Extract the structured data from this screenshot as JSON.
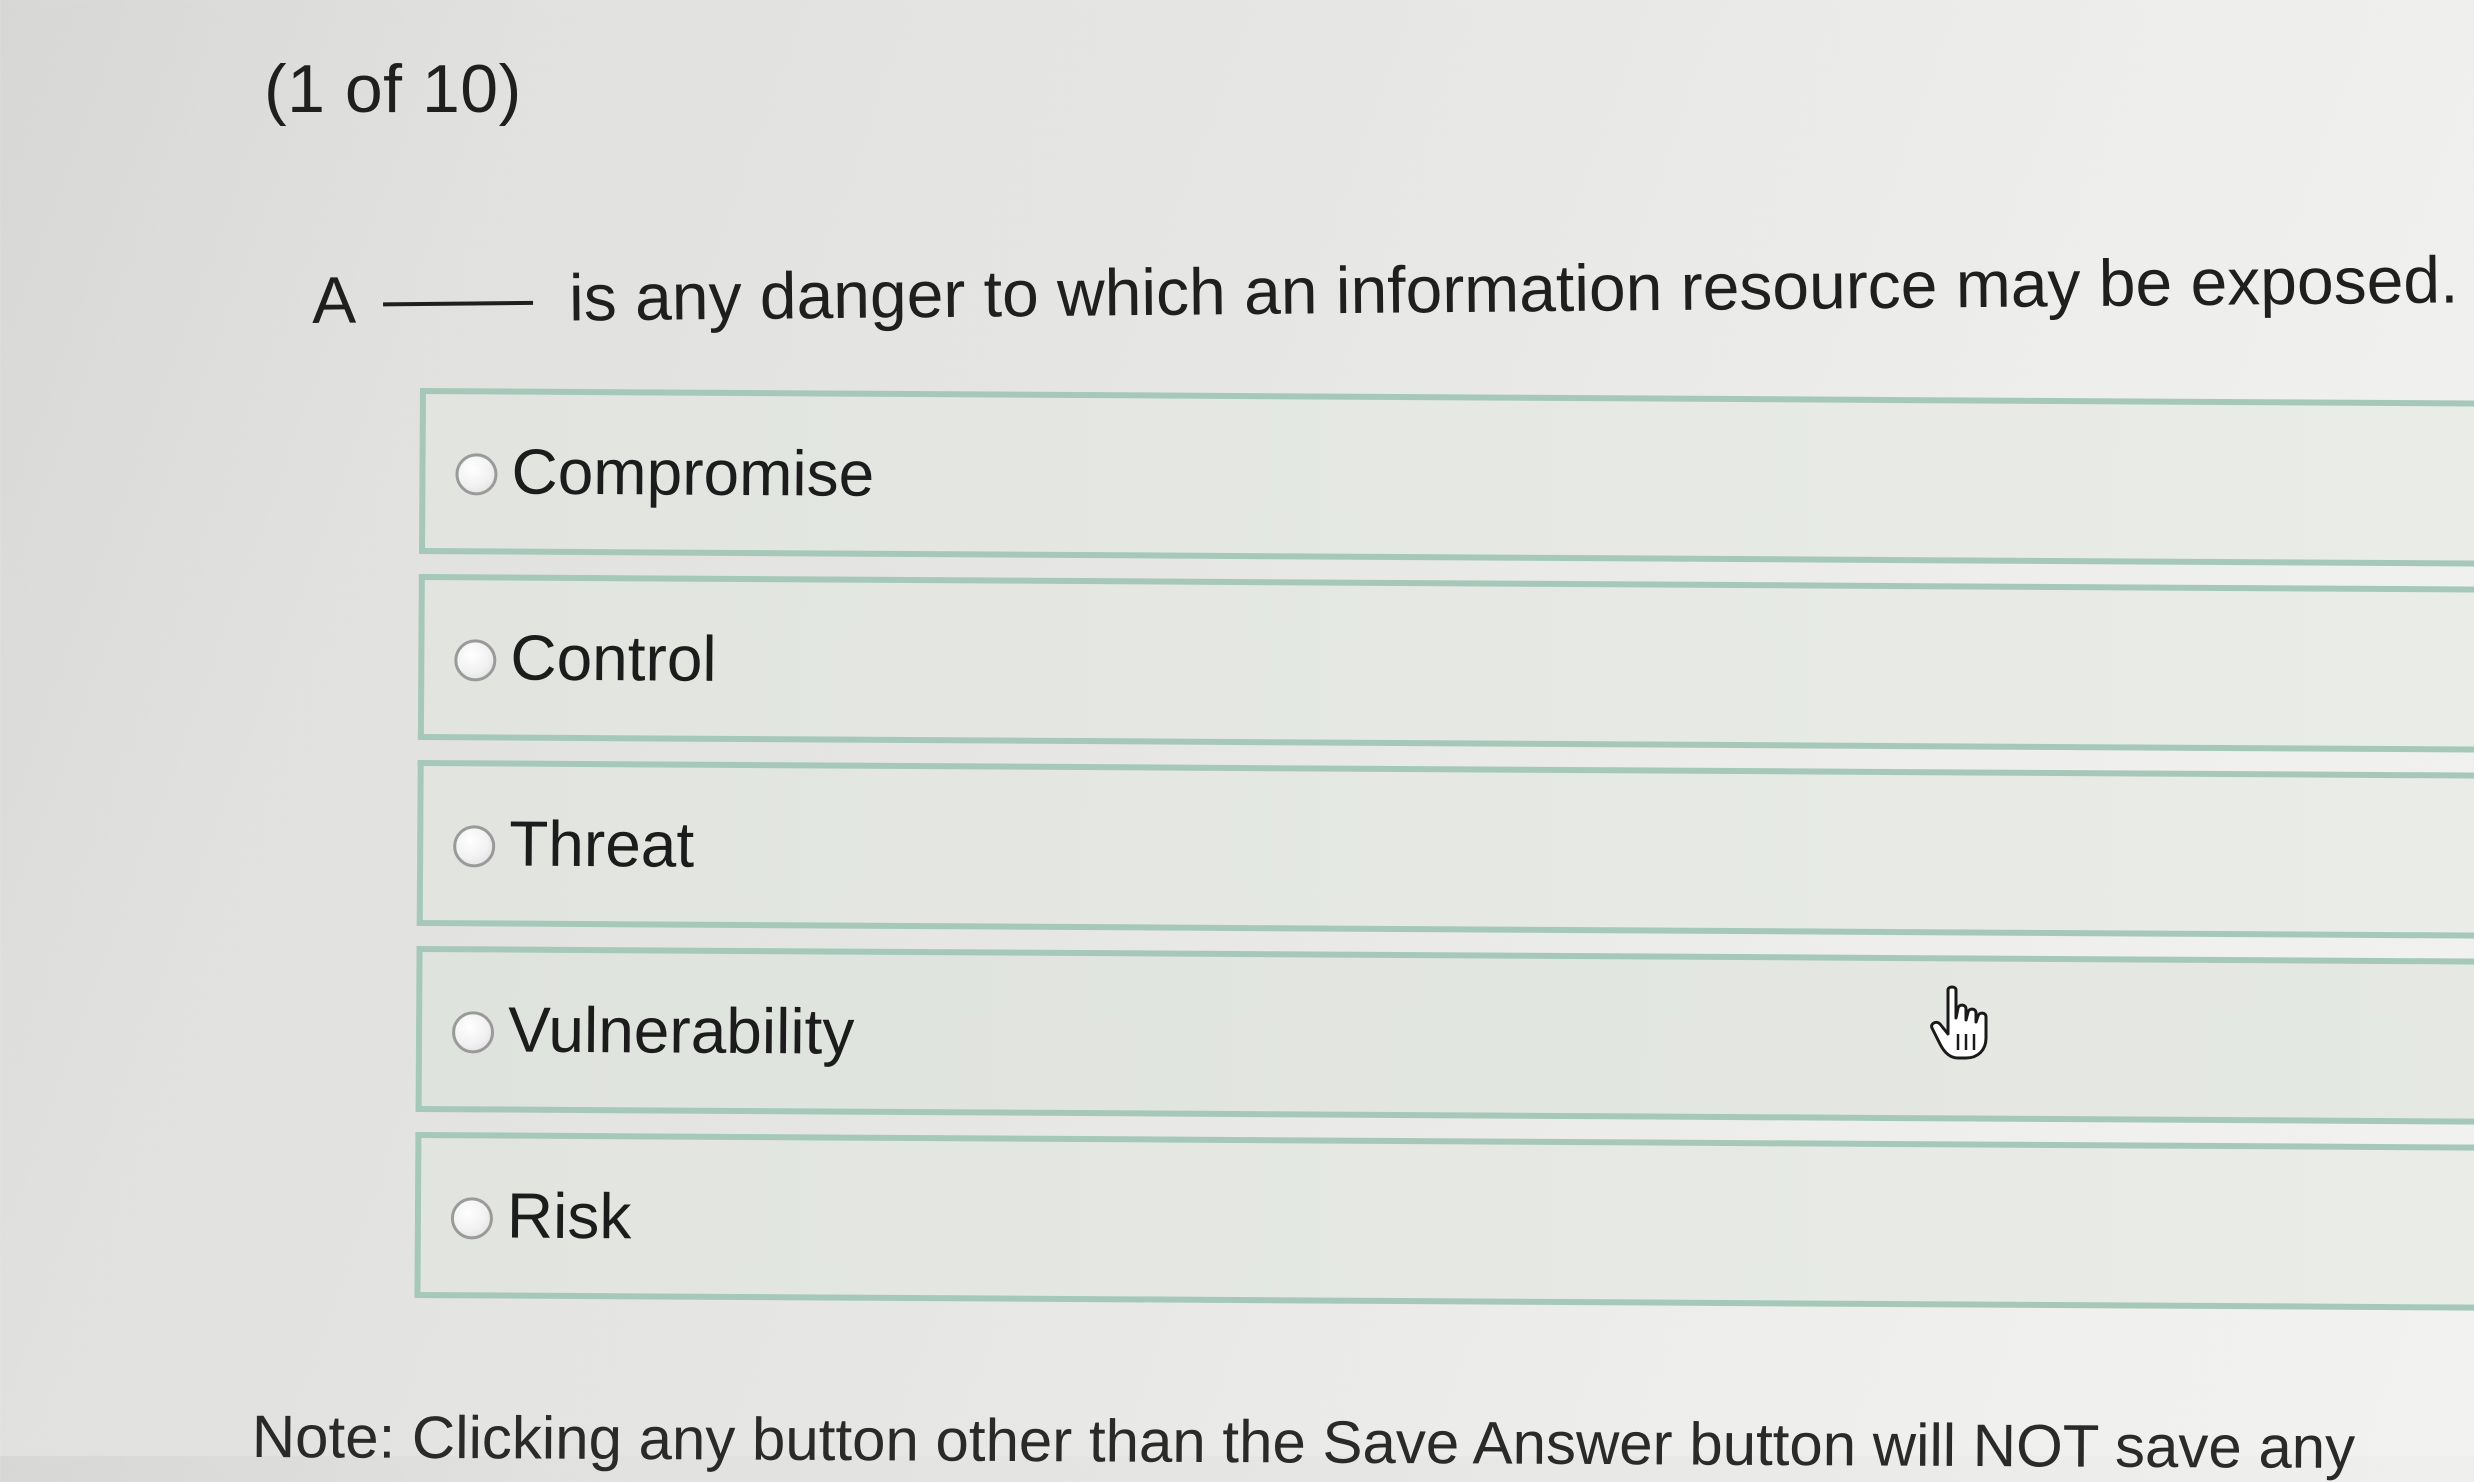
{
  "counter": "(1 of 10)",
  "question": {
    "prefix": "A",
    "suffix": "is any danger to which an information resource may be exposed."
  },
  "options": [
    {
      "label": "Compromise",
      "selected": false
    },
    {
      "label": "Control",
      "selected": false
    },
    {
      "label": "Threat",
      "selected": false
    },
    {
      "label": "Vulnerability",
      "selected": false
    },
    {
      "label": "Risk",
      "selected": false
    }
  ],
  "cursor_icon": "pointer-hand-icon",
  "note": "Note: Clicking any button other than the Save Answer button will NOT save any"
}
